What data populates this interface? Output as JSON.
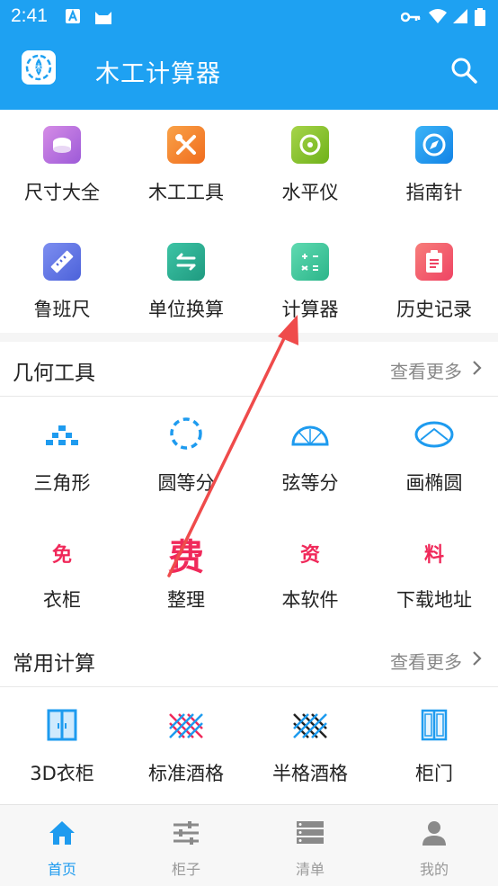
{
  "status": {
    "time": "2:41"
  },
  "appbar": {
    "title": "木工计算器"
  },
  "tools": [
    {
      "label": "尺寸大全",
      "icon": "ruler-tape-icon",
      "color": "#b56de0"
    },
    {
      "label": "木工工具",
      "icon": "tools-icon",
      "color": "#f58a2a"
    },
    {
      "label": "水平仪",
      "icon": "level-icon",
      "color": "#8fc62b"
    },
    {
      "label": "指南针",
      "icon": "compass-icon",
      "color": "#1f9ef2"
    },
    {
      "label": "鲁班尺",
      "icon": "ruler-icon",
      "color": "#5a78e6"
    },
    {
      "label": "单位换算",
      "icon": "convert-icon",
      "color": "#2bb89a"
    },
    {
      "label": "计算器",
      "icon": "calculator-icon",
      "color": "#44ca9c"
    },
    {
      "label": "历史记录",
      "icon": "history-icon",
      "color": "#f2596b"
    }
  ],
  "geometry": {
    "title": "几何工具",
    "more": "查看更多",
    "items": [
      {
        "label": "三角形",
        "icon": "triangle-icon"
      },
      {
        "label": "圆等分",
        "icon": "circle-divide-icon"
      },
      {
        "label": "弦等分",
        "icon": "chord-divide-icon"
      },
      {
        "label": "画椭圆",
        "icon": "ellipse-icon"
      },
      {
        "label": "衣柜",
        "glyph": "免"
      },
      {
        "label": "整理",
        "glyph": "费"
      },
      {
        "label": "本软件",
        "glyph": "资"
      },
      {
        "label": "下载地址",
        "glyph": "料"
      }
    ]
  },
  "common": {
    "title": "常用计算",
    "more": "查看更多",
    "items": [
      {
        "label": "3D衣柜",
        "icon": "wardrobe-icon"
      },
      {
        "label": "标准酒格",
        "icon": "wine-rack-icon"
      },
      {
        "label": "半格酒格",
        "icon": "half-wine-rack-icon"
      },
      {
        "label": "柜门",
        "icon": "cabinet-door-icon"
      }
    ]
  },
  "tabs": [
    {
      "label": "首页",
      "icon": "home-icon",
      "active": true
    },
    {
      "label": "柜子",
      "icon": "sliders-icon"
    },
    {
      "label": "清单",
      "icon": "list-icon"
    },
    {
      "label": "我的",
      "icon": "user-icon"
    }
  ],
  "colors": {
    "primary": "#1ea1f2",
    "accent_red": "#f0295a",
    "annotation_arrow": "#ef4b4b"
  }
}
